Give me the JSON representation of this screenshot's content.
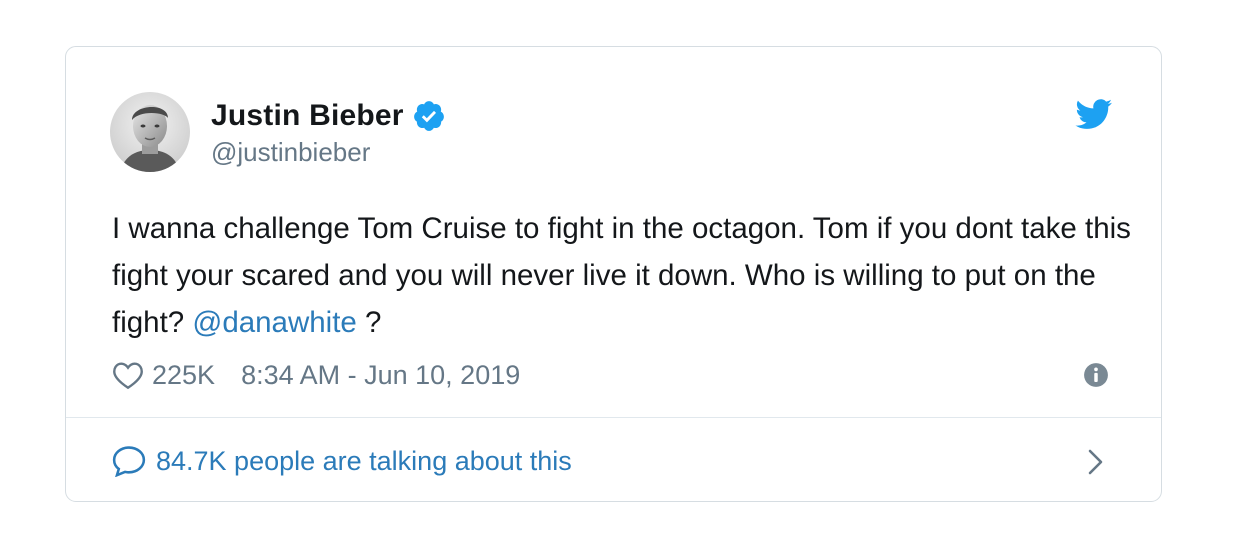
{
  "author": {
    "name": "Justin Bieber",
    "handle": "@justinbieber"
  },
  "tweet": {
    "text_before_mention": "I wanna challenge Tom Cruise to fight in the octagon. Tom if you dont take this fight your scared and you will never live it down. Who is willing to put on the fight? ",
    "mention": "@danawhite",
    "text_after_mention": " ?"
  },
  "meta": {
    "likes": "225K",
    "timestamp": "8:34 AM - Jun 10, 2019"
  },
  "footer": {
    "talking_label": "84.7K people are talking about this"
  },
  "icons": {
    "verified": "verified-badge-icon",
    "brand": "twitter-bird-icon",
    "like": "heart-icon",
    "info": "info-icon",
    "conversation": "speech-bubble-icon",
    "chevron": "chevron-right-icon"
  },
  "colors": {
    "twitter_blue": "#1da1f2",
    "link_blue": "#2b7bb9",
    "text": "#14171a",
    "muted": "#657786"
  }
}
